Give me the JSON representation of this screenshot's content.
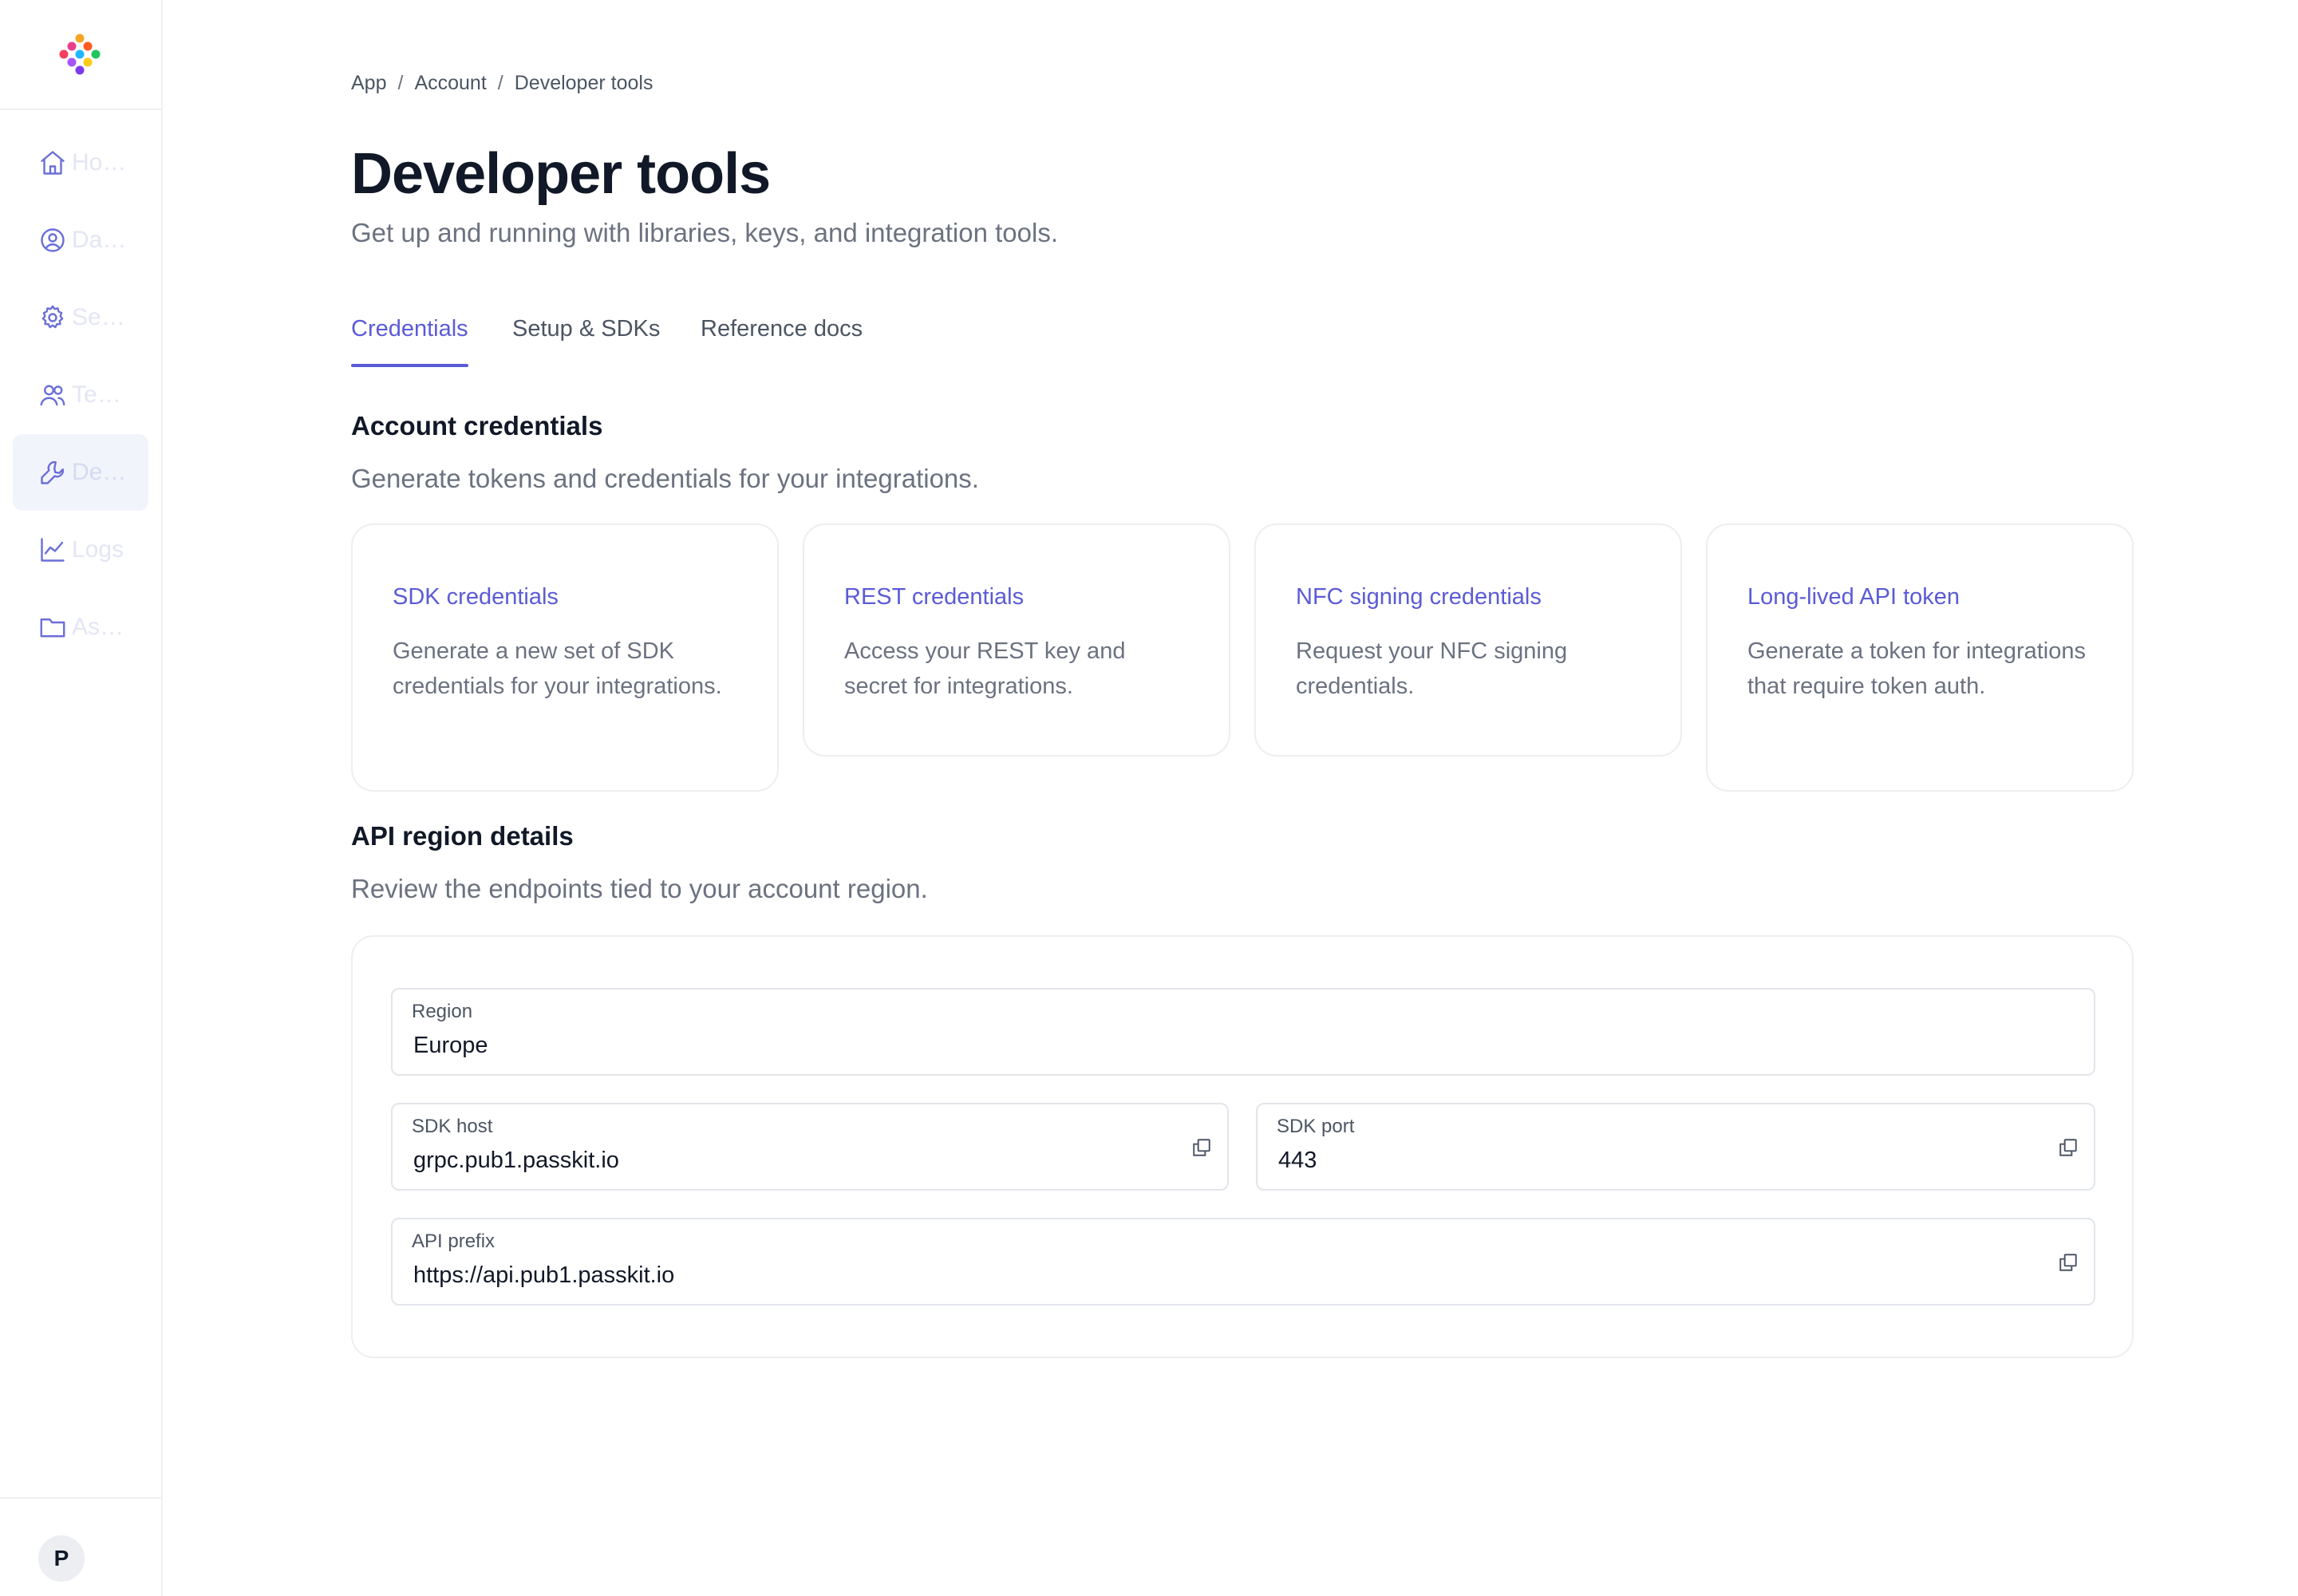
{
  "sidebar": {
    "items": [
      {
        "label": "Home",
        "icon": "home-icon"
      },
      {
        "label": "Dashboard",
        "icon": "user-circle-icon"
      },
      {
        "label": "Settings",
        "icon": "gear-icon"
      },
      {
        "label": "Teams",
        "icon": "users-icon"
      },
      {
        "label": "Developer tools",
        "icon": "wrench-icon",
        "active": true
      },
      {
        "label": "Logs",
        "icon": "chart-line-icon"
      },
      {
        "label": "Assets",
        "icon": "folder-icon"
      }
    ],
    "avatar_initial": "P"
  },
  "breadcrumb": {
    "items": [
      "App",
      "Account",
      "Developer tools"
    ],
    "separator": "/"
  },
  "page": {
    "title": "Developer tools",
    "subtitle": "Get up and running with libraries, keys, and integration tools."
  },
  "tabs": [
    {
      "label": "Credentials",
      "active": true
    },
    {
      "label": "Setup & SDKs",
      "active": false
    },
    {
      "label": "Reference docs",
      "active": false
    }
  ],
  "credentials_section": {
    "title": "Account credentials",
    "description": "Generate tokens and credentials for your integrations.",
    "cards": [
      {
        "title": "SDK credentials",
        "description": "Generate a new set of SDK credentials for your integrations."
      },
      {
        "title": "REST credentials",
        "description": "Access your REST key and secret for integrations."
      },
      {
        "title": "NFC signing credentials",
        "description": "Request your NFC signing credentials."
      },
      {
        "title": "Long-lived API token",
        "description": "Generate a token for integrations that require token auth."
      }
    ]
  },
  "region_section": {
    "title": "API region details",
    "description": "Review the endpoints tied to your account region.",
    "region": {
      "label": "Region",
      "value": "Europe"
    },
    "sdk_host": {
      "label": "SDK host",
      "value": "grpc.pub1.passkit.io"
    },
    "sdk_port": {
      "label": "SDK port",
      "value": "443"
    },
    "api_prefix": {
      "label": "API prefix",
      "value": "https://api.pub1.passkit.io"
    }
  },
  "colors": {
    "accent": "#5b5bd6",
    "nav_icon": "#6a6fd8",
    "text_primary": "#111827",
    "text_muted": "#6b7280",
    "border": "#eceef1"
  }
}
